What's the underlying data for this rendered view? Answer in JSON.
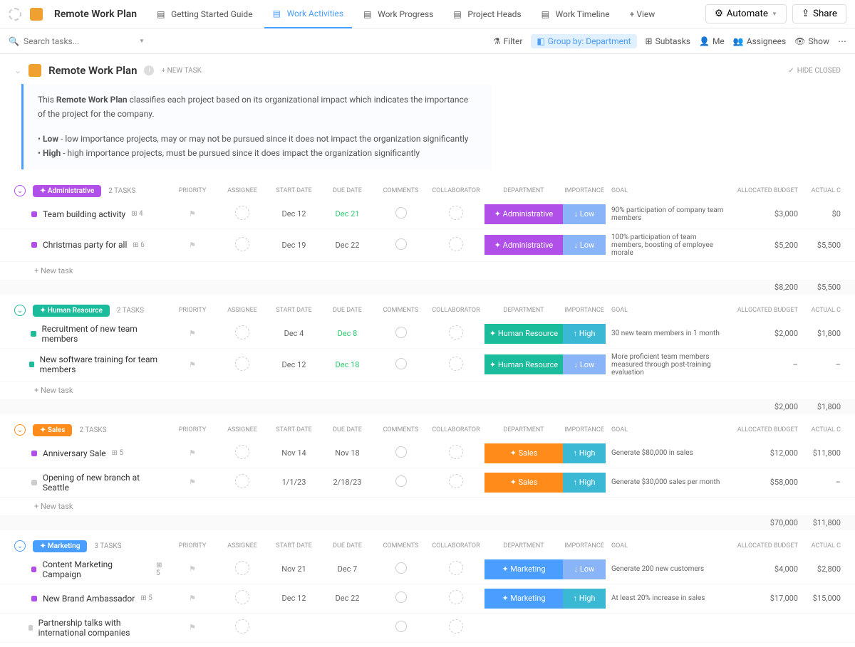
{
  "nav": {
    "title": "Remote Work Plan",
    "tabs": [
      {
        "label": "Getting Started Guide"
      },
      {
        "label": "Work Activities",
        "active": true
      },
      {
        "label": "Work Progress"
      },
      {
        "label": "Project Heads"
      },
      {
        "label": "Work Timeline"
      }
    ],
    "view": "+ View",
    "automate": "Automate",
    "share": "Share"
  },
  "toolbar": {
    "search_placeholder": "Search tasks...",
    "filter": "Filter",
    "group_by": "Group by: Department",
    "subtasks": "Subtasks",
    "me": "Me",
    "assignees": "Assignees",
    "show": "Show"
  },
  "header": {
    "title": "Remote Work Plan",
    "new_task": "+ NEW TASK",
    "hide_closed": "HIDE CLOSED"
  },
  "description": {
    "line1_pre": "This ",
    "line1_bold": "Remote Work Plan",
    "line1_post": " classifies each project based on its organizational impact which indicates the importance of the project for the company.",
    "bullet1_bold": "Low",
    "bullet1_text": " - low importance projects, may or may not be pursued since it does not impact the organization significantly",
    "bullet2_bold": "High",
    "bullet2_text": " - high importance projects, must be pursued since it does impact the organization significantly"
  },
  "columns": {
    "priority": "PRIORITY",
    "assignee": "ASSIGNEE",
    "start": "START DATE",
    "due": "DUE DATE",
    "comments": "COMMENTS",
    "collab": "COLLABORATOR",
    "dept": "DEPARTMENT",
    "imp": "IMPORTANCE",
    "goal": "GOAL",
    "budget": "ALLOCATED BUDGET",
    "actual": "ACTUAL C"
  },
  "new_task_label": "+ New task",
  "groups": [
    {
      "name": "Administrative",
      "color": "#b050e8",
      "count": "2 TASKS",
      "tasks": [
        {
          "bullet": "#b050e8",
          "name": "Team building activity",
          "sub": "4",
          "start": "Dec 12",
          "due": "Dec 21",
          "due_color": "#2ecc71",
          "dept": "Administrative",
          "dept_color": "#b050e8",
          "imp": "Low",
          "imp_color": "#8ab4f8",
          "imp_arrow": "↓",
          "goal": "90% participation of company team members",
          "budget": "$3,000",
          "actual": "$0"
        },
        {
          "bullet": "#b050e8",
          "name": "Christmas party for all",
          "sub": "6",
          "start": "Dec 19",
          "due": "Dec 22",
          "due_color": "#666",
          "dept": "Administrative",
          "dept_color": "#b050e8",
          "imp": "Low",
          "imp_color": "#8ab4f8",
          "imp_arrow": "↓",
          "goal": "100% participation of team members, boosting of employee morale",
          "budget": "$5,200",
          "actual": "$5,500"
        }
      ],
      "total_budget": "$8,200",
      "total_actual": "$5,500"
    },
    {
      "name": "Human Resource",
      "color": "#1abc9c",
      "count": "2 TASKS",
      "tasks": [
        {
          "bullet": "#1abc9c",
          "name": "Recruitment of new team members",
          "sub": "",
          "start": "Dec 4",
          "due": "Dec 8",
          "due_color": "#2ecc71",
          "dept": "Human Resource",
          "dept_color": "#1abc9c",
          "imp": "High",
          "imp_color": "#3bb8d4",
          "imp_arrow": "↑",
          "goal": "30 new team members in 1 month",
          "budget": "$2,000",
          "actual": "$1,800"
        },
        {
          "bullet": "#1abc9c",
          "name": "New software training for team members",
          "sub": "",
          "start": "Dec 12",
          "due": "Dec 18",
          "due_color": "#2ecc71",
          "dept": "Human Resource",
          "dept_color": "#1abc9c",
          "imp": "Low",
          "imp_color": "#8ab4f8",
          "imp_arrow": "↓",
          "goal": "More proficient team members measured through post-training evaluation",
          "budget": "–",
          "actual": "–"
        }
      ],
      "total_budget": "$2,000",
      "total_actual": "$1,800"
    },
    {
      "name": "Sales",
      "color": "#ff8c1a",
      "count": "2 TASKS",
      "tasks": [
        {
          "bullet": "#b050e8",
          "name": "Anniversary Sale",
          "sub": "5",
          "start": "Nov 14",
          "due": "Nov 18",
          "due_color": "#666",
          "dept": "Sales",
          "dept_color": "#ff8c1a",
          "imp": "High",
          "imp_color": "#3bb8d4",
          "imp_arrow": "↑",
          "goal": "Generate $80,000 in sales",
          "budget": "$12,000",
          "actual": "$11,800"
        },
        {
          "bullet": "#ccc",
          "name": "Opening of new branch at Seattle",
          "sub": "",
          "start": "1/1/23",
          "due": "2/18/23",
          "due_color": "#666",
          "dept": "Sales",
          "dept_color": "#ff8c1a",
          "imp": "High",
          "imp_color": "#3bb8d4",
          "imp_arrow": "↑",
          "goal": "Generate $30,000 sales per month",
          "budget": "$58,000",
          "actual": "–"
        }
      ],
      "total_budget": "$70,000",
      "total_actual": "$11,800"
    },
    {
      "name": "Marketing",
      "color": "#4a9eff",
      "count": "3 TASKS",
      "tasks": [
        {
          "bullet": "#b050e8",
          "name": "Content Marketing Campaign",
          "sub": "5",
          "start": "Nov 21",
          "due": "Dec 7",
          "due_color": "#666",
          "dept": "Marketing",
          "dept_color": "#4a9eff",
          "imp": "Low",
          "imp_color": "#8ab4f8",
          "imp_arrow": "↓",
          "goal": "Generate 200 new customers",
          "budget": "$4,000",
          "actual": "$2,800"
        },
        {
          "bullet": "#b050e8",
          "name": "New Brand Ambassador",
          "sub": "5",
          "start": "Dec 12",
          "due": "Dec 22",
          "due_color": "#666",
          "dept": "Marketing",
          "dept_color": "#4a9eff",
          "imp": "High",
          "imp_color": "#3bb8d4",
          "imp_arrow": "↑",
          "goal": "At least 20% increase in sales",
          "budget": "$17,000",
          "actual": "$15,000"
        },
        {
          "bullet": "#ccc",
          "name": "Partnership talks with international companies",
          "sub": "",
          "start": "",
          "due": "",
          "due_color": "",
          "dept": "",
          "dept_color": "",
          "imp": "",
          "imp_color": "",
          "imp_arrow": "",
          "goal": "",
          "budget": "",
          "actual": ""
        }
      ]
    }
  ]
}
